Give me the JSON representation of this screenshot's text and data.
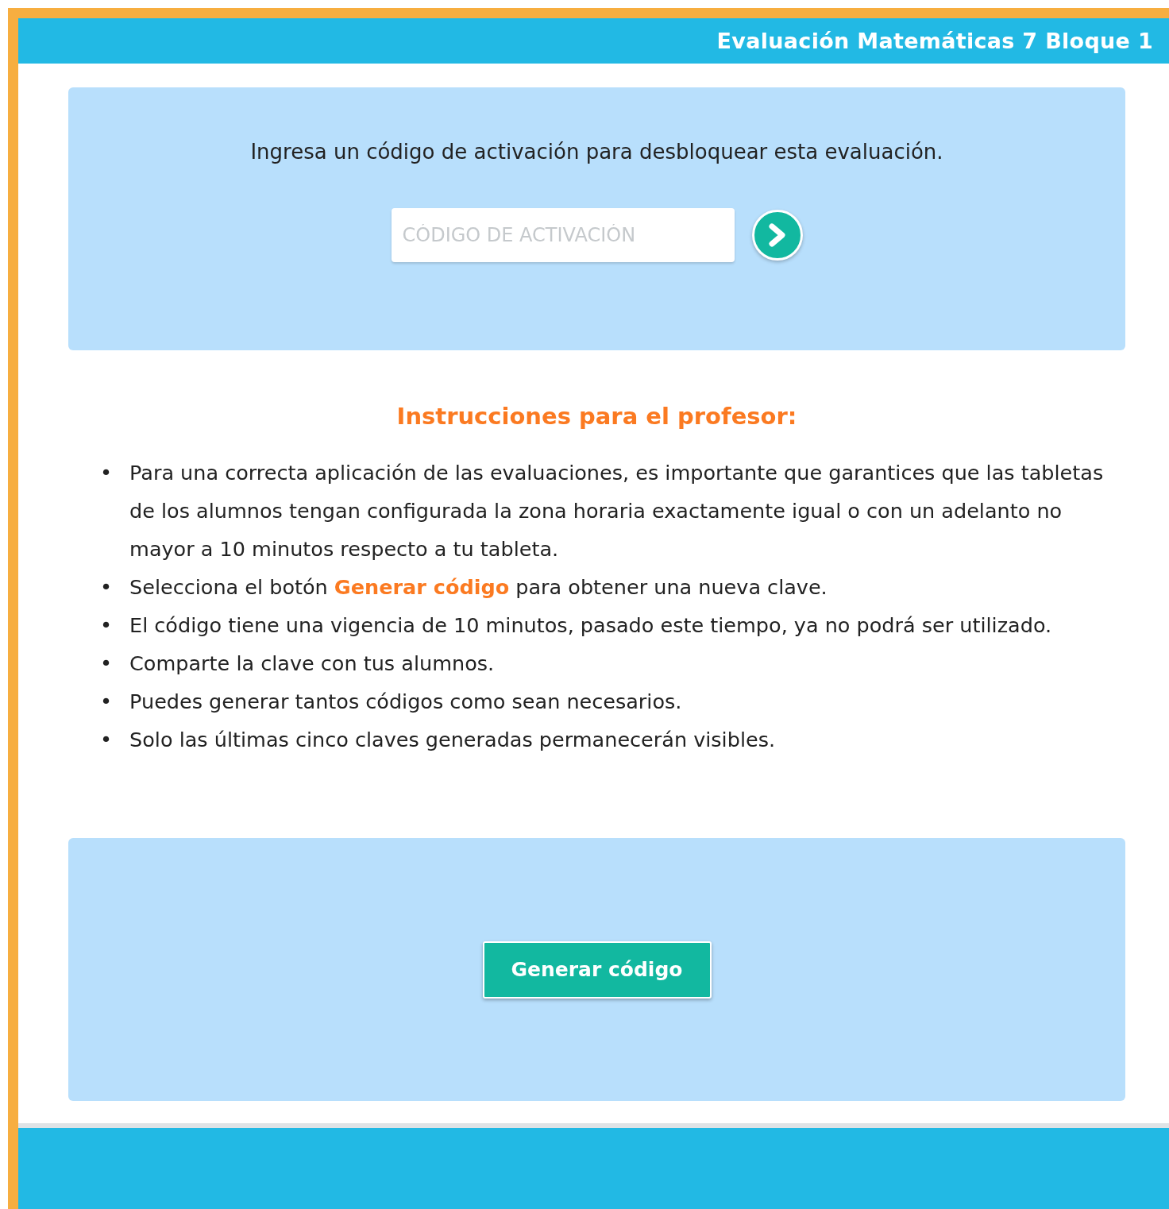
{
  "header": {
    "title": "Evaluación Matemáticas 7 Bloque 1"
  },
  "activation": {
    "prompt": "Ingresa un código de activación para desbloquear esta evaluación.",
    "placeholder": "CÓDIGO DE ACTIVACIÓN"
  },
  "instructions": {
    "title": "Instrucciones para el profesor:",
    "items": [
      {
        "marker": "•",
        "text": "Para una correcta aplicación de las evaluaciones, es importante que garantices que las tabletas de los alumnos tengan configurada la zona horaria exactamente igual o con un adelanto no mayor a 10 minutos respecto a tu tableta."
      },
      {
        "marker": "•",
        "text": "Selecciona el botón **Generar código** para obtener una nueva clave."
      },
      {
        "marker": "•",
        "text": "El código tiene una vigencia de 10 minutos, pasado este tiempo, ya no podrá ser utilizado."
      },
      {
        "marker": "•",
        "text": "Comparte la clave con tus alumnos."
      },
      {
        "marker": "•",
        "text": "Puedes generar tantos códigos como sean necesarios."
      },
      {
        "marker": "•",
        "text": "Solo las últimas cinco claves generadas permanecerán visibles."
      }
    ]
  },
  "generate": {
    "button": "Generar código"
  }
}
